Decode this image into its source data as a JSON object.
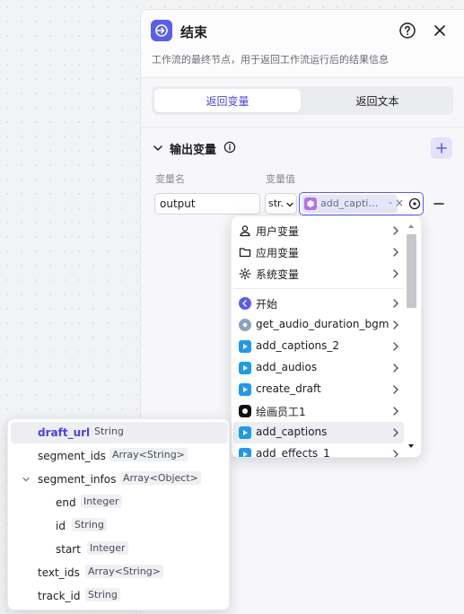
{
  "panel": {
    "title": "结束",
    "description": "工作流的最终节点，用于返回工作流运行后的结果信息",
    "tabs": [
      {
        "label": "返回变量",
        "active": true
      },
      {
        "label": "返回文本",
        "active": false
      }
    ],
    "output_section": {
      "title": "输出变量",
      "col_name": "变量名",
      "col_value": "变量值",
      "row": {
        "name_value": "output",
        "type_value": "str.",
        "ref_label": "add_capti…",
        "ref_dash": "-",
        "clear_glyph": "×"
      }
    }
  },
  "dropdown": {
    "groups": [
      {
        "label": "用户变量",
        "icon": "user-icon"
      },
      {
        "label": "应用变量",
        "icon": "folder-icon"
      },
      {
        "label": "系统变量",
        "icon": "gear-icon"
      }
    ],
    "nodes": [
      {
        "label": "开始",
        "icon": "start-node-icon"
      },
      {
        "label": "get_audio_duration_bgm",
        "icon": "plugin-icon"
      },
      {
        "label": "add_captions_2",
        "icon": "jianying-icon"
      },
      {
        "label": "add_audios",
        "icon": "jianying-icon"
      },
      {
        "label": "create_draft",
        "icon": "jianying-icon"
      },
      {
        "label": "绘画员工1",
        "icon": "painter-icon"
      },
      {
        "label": "add_captions",
        "icon": "jianying-icon",
        "highlighted": true
      },
      {
        "label": "add_effects_1",
        "icon": "jianying-icon"
      }
    ]
  },
  "subpanel": {
    "fields": [
      {
        "name": "draft_url",
        "type": "String",
        "level": 0,
        "selected": true
      },
      {
        "name": "segment_ids",
        "type": "Array<String>",
        "level": 0
      },
      {
        "name": "segment_infos",
        "type": "Array<Object>",
        "level": 0,
        "expanded": true
      },
      {
        "name": "end",
        "type": "Integer",
        "level": 1
      },
      {
        "name": "id",
        "type": "String",
        "level": 1
      },
      {
        "name": "start",
        "type": "Integer",
        "level": 1
      },
      {
        "name": "text_ids",
        "type": "Array<String>",
        "level": 0
      },
      {
        "name": "track_id",
        "type": "String",
        "level": 0
      }
    ]
  },
  "colors": {
    "accent": "#5b5cf0",
    "accent_text": "#4e40e5",
    "chip_bg": "#e7e5fc",
    "jianying_blue": "#1a9bf0"
  }
}
